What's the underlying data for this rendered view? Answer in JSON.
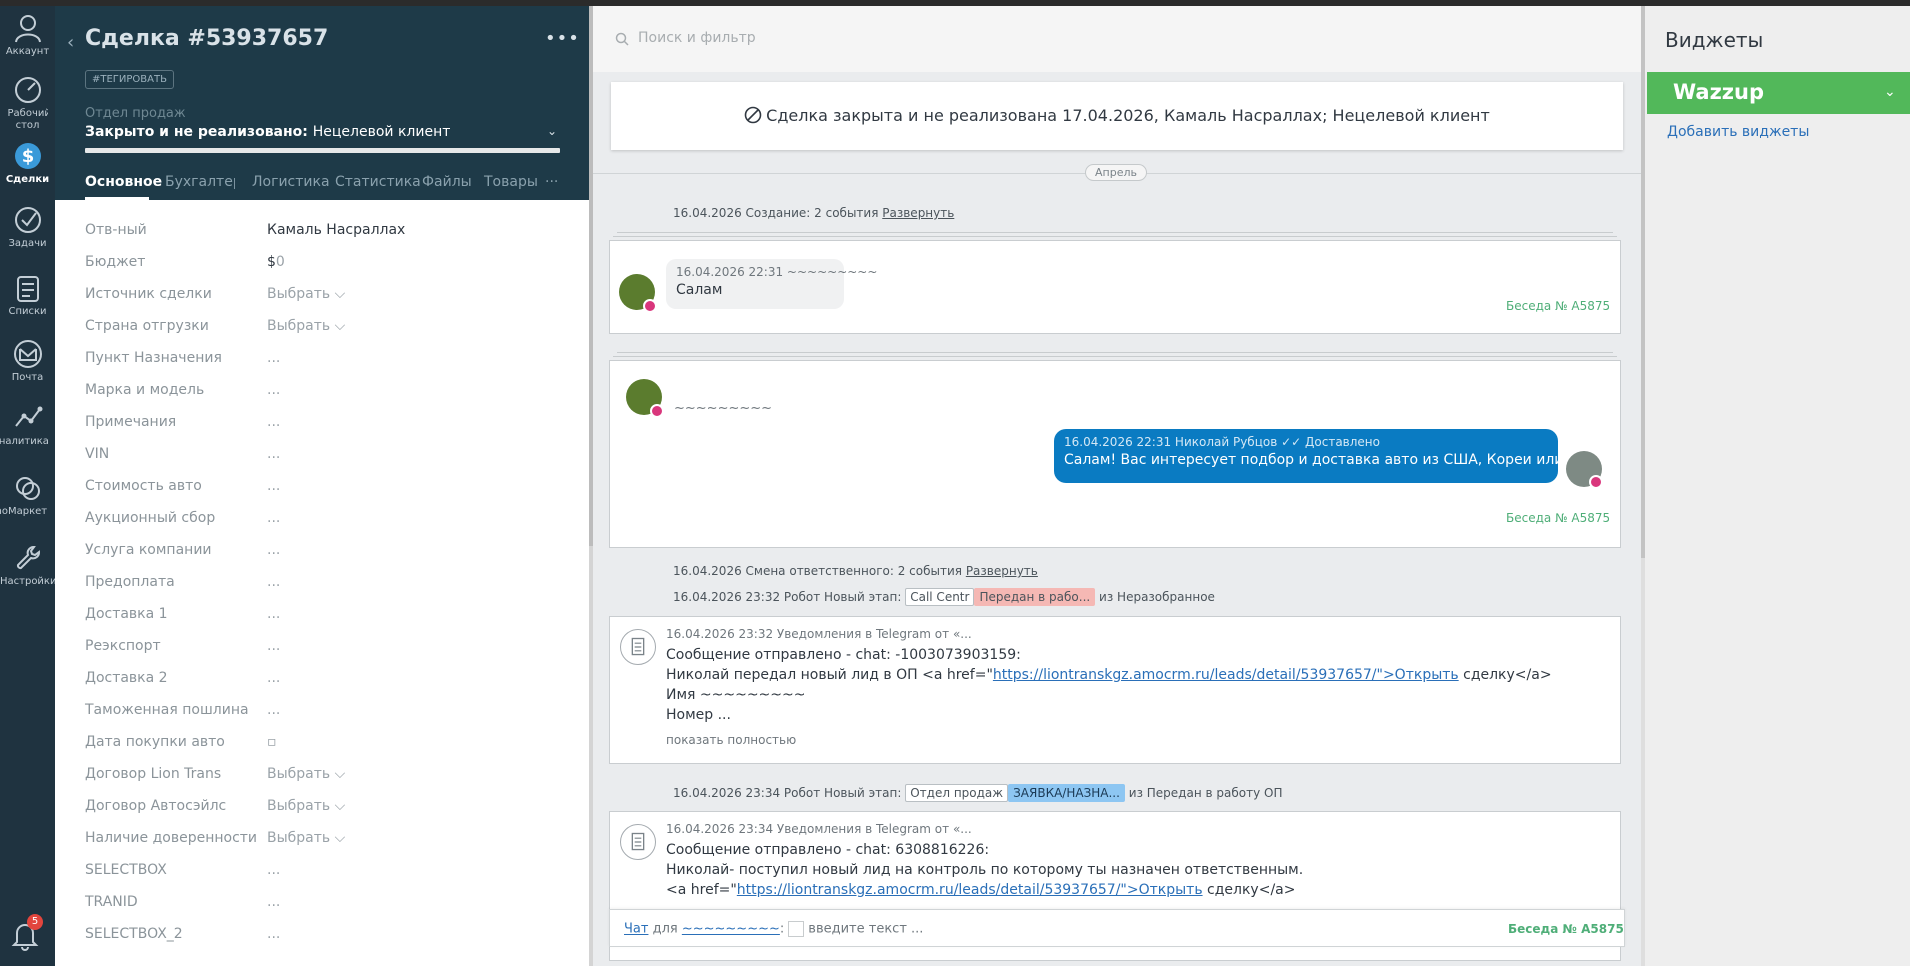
{
  "nav": {
    "items": [
      {
        "label": "Аккаунт",
        "icon": "account-icon"
      },
      {
        "label": "Рабочий стол",
        "icon": "dashboard-icon"
      },
      {
        "label": "Сделки",
        "icon": "deals-icon"
      },
      {
        "label": "Задачи",
        "icon": "tasks-icon"
      },
      {
        "label": "Списки",
        "icon": "lists-icon"
      },
      {
        "label": "Почта",
        "icon": "mail-icon"
      },
      {
        "label": "Аналитика",
        "icon": "analytics-icon"
      },
      {
        "label": "amoМаркет",
        "icon": "market-icon"
      },
      {
        "label": "Настройки",
        "icon": "settings-icon"
      }
    ],
    "notifications_count": "5"
  },
  "card": {
    "title": "Сделка #53937657",
    "tag_button": "#ТЕГИРОВАТЬ",
    "pipeline_label": "Отдел продаж",
    "status_main": "Закрыто и не реализовано:",
    "status_sub": "Нецелевой клиент",
    "tabs": [
      "Основное",
      "Бухгалтерия",
      "Логистика",
      "Статистика",
      "Файлы",
      "Товары"
    ],
    "tab_more": "···"
  },
  "fields": [
    {
      "key": "Отв-ный",
      "value": "Камаль Насраллах"
    },
    {
      "key": "Бюджет",
      "value": "$",
      "zero": "0"
    },
    {
      "key": "Источник сделки",
      "value": "Выбрать ⌵"
    },
    {
      "key": "Страна отгрузки",
      "value": "Выбрать ⌵"
    },
    {
      "key": "Пункт Назначения",
      "value": "..."
    },
    {
      "key": "Марка и модель",
      "value": "..."
    },
    {
      "key": "Примечания",
      "value": "..."
    },
    {
      "key": "VIN",
      "value": "..."
    },
    {
      "key": "Стоимость авто",
      "value": "..."
    },
    {
      "key": "Аукционный сбор",
      "value": "..."
    },
    {
      "key": "Услуга компании",
      "value": "..."
    },
    {
      "key": "Предоплата",
      "value": "..."
    },
    {
      "key": "Доставка 1",
      "value": "..."
    },
    {
      "key": "Реэкспорт",
      "value": "..."
    },
    {
      "key": "Доставка 2",
      "value": "..."
    },
    {
      "key": "Таможенная пошлина",
      "value": "..."
    },
    {
      "key": "Дата покупки авто",
      "value": "▫"
    },
    {
      "key": "Договор Lion Trans",
      "value": "Выбрать ⌵"
    },
    {
      "key": "Договор Автосэйлс",
      "value": "Выбрать ⌵"
    },
    {
      "key": "Наличие довереннoсти",
      "value": "Выбрать ⌵"
    },
    {
      "key": "SELECTBOX",
      "value": "..."
    },
    {
      "key": "TRANID",
      "value": "..."
    },
    {
      "key": "SELECTBOX_2",
      "value": "..."
    }
  ],
  "feed": {
    "search_placeholder": "Поиск и фильтр",
    "closed_banner": "Сделка закрыта и не реализована 17.04.2026, Камаль Насраллах; Нецелевой клиент",
    "month": "Апрель",
    "ev_create": "16.04.2026 Создание: 2 события",
    "expand": "Развернуть",
    "msg1": {
      "meta": "16.04.2026 22:31 ~~~~~~~~~",
      "text": "Салам",
      "conv": "Беседа № A5875"
    },
    "msg2": {
      "tilde": "~~~~~~~~~",
      "meta": "16.04.2026 22:31 Николай Рубцов  ✓✓ Доставлено",
      "text": "Салам! Вас интересует подбор и доставка авто из США, Кореи или Китая?",
      "conv": "Беседа № A5875"
    },
    "ev_resp": "16.04.2026 Смена ответственного: 2 события",
    "ev_stage1": {
      "prefix": "16.04.2026 23:32 Робот Новый этап:",
      "tag1": "Call Centr",
      "tag2": "Передан в рабо...",
      "suffix": "из Неразобранное"
    },
    "note1": {
      "meta": "16.04.2026 23:32 Уведомления в Telegram от «...",
      "l1": "Сообщение отправлено - chat: -1003073903159:",
      "l2a": "Николай передал новый лид в ОП <a href=\"",
      "l2link": "https://liontranskgz.amocrm.ru/leads/detail/53937657/\">Открыть",
      "l2b": " сделку</a>",
      "l3": "Имя ~~~~~~~~~",
      "l4": "Номер ...",
      "more": "показать полностью"
    },
    "ev_stage2": {
      "prefix": "16.04.2026 23:34 Робот Новый этап:",
      "tag1": "Отдел продаж",
      "tag2": "ЗАЯВКА/НАЗНА...",
      "suffix": "из Передан в работу ОП"
    },
    "note2": {
      "meta": "16.04.2026 23:34 Уведомления в Telegram от «...",
      "l1": "Сообщение отправлено - chat: 6308816226:",
      "l2": "Николай- поступил новый лид на контроль по которому ты назначен ответственным.",
      "l3a": "<a href=\"",
      "l3link": "https://liontranskgz.amocrm.ru/leads/detail/53937657/\">Открыть",
      "l3b": " сделку</a>"
    },
    "chat": {
      "chat_link": "Чат",
      "for": " для ",
      "contact": "~~~~~~~~~",
      "colon": ":",
      "placeholder": "введите текст ...",
      "conv": "Беседа № A5875"
    }
  },
  "widgets": {
    "title": "Виджеты",
    "wazzup": "Wazzup",
    "add": "Добавить виджеты"
  },
  "colors": {
    "nav_bg": "#1f3340",
    "header_bg": "#1e3a48",
    "accent_green": "#52b85a",
    "link_blue": "#2a6fb8",
    "bubble_blue": "#0a7bc2"
  }
}
